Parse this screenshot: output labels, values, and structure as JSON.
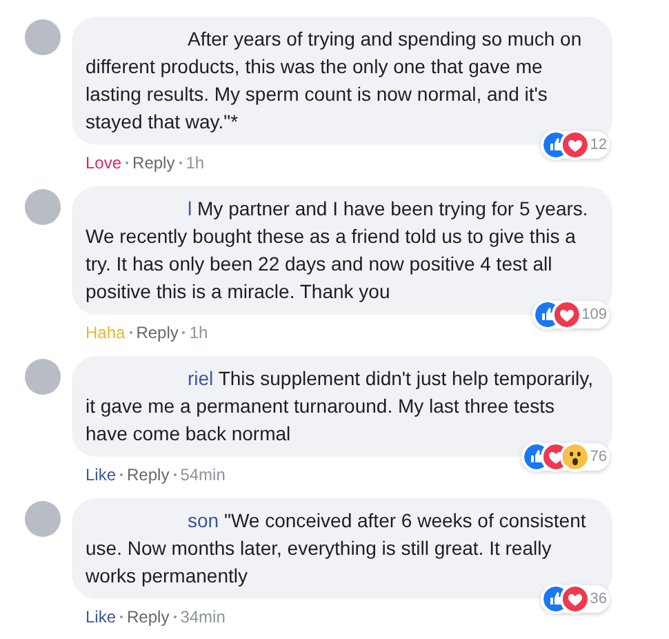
{
  "comments": [
    {
      "text": "After years of trying and spending so much on different products, this was the only one that gave me lasting results. My sperm count is now normal, and it's stayed that way.\"*",
      "reactions": [
        {
          "kind": "like"
        },
        {
          "kind": "love"
        }
      ],
      "reaction_count": "12",
      "my_reaction": {
        "kind": "love",
        "label": "Love"
      },
      "reply": "Reply",
      "time": "1h"
    },
    {
      "name_fragment": "l",
      "text": "My partner and I have been trying for 5 years. We recently bought these as a friend told us to give this a try. It has only been 22 days and now positive 4 test all positive this is a miracle. Thank you",
      "reactions": [
        {
          "kind": "like"
        },
        {
          "kind": "love"
        }
      ],
      "reaction_count": "109",
      "my_reaction": {
        "kind": "haha",
        "label": "Haha"
      },
      "reply": "Reply",
      "time": "1h"
    },
    {
      "name_fragment": "riel",
      "text": "This supplement didn't just help temporarily, it gave me a permanent turnaround. My last three tests have come back normal",
      "reactions": [
        {
          "kind": "like"
        },
        {
          "kind": "love"
        },
        {
          "kind": "wow"
        }
      ],
      "reaction_count": "76",
      "my_reaction": {
        "kind": "like",
        "label": "Like"
      },
      "reply": "Reply",
      "time": "54min"
    },
    {
      "name_fragment": "son",
      "text": "\"We conceived after 6 weeks of consistent use. Now months later, everything is still great. It really works permanently",
      "reactions": [
        {
          "kind": "like"
        },
        {
          "kind": "love"
        }
      ],
      "reaction_count": "36",
      "my_reaction": {
        "kind": "like",
        "label": "Like"
      },
      "reply": "Reply",
      "time": "34min"
    }
  ]
}
